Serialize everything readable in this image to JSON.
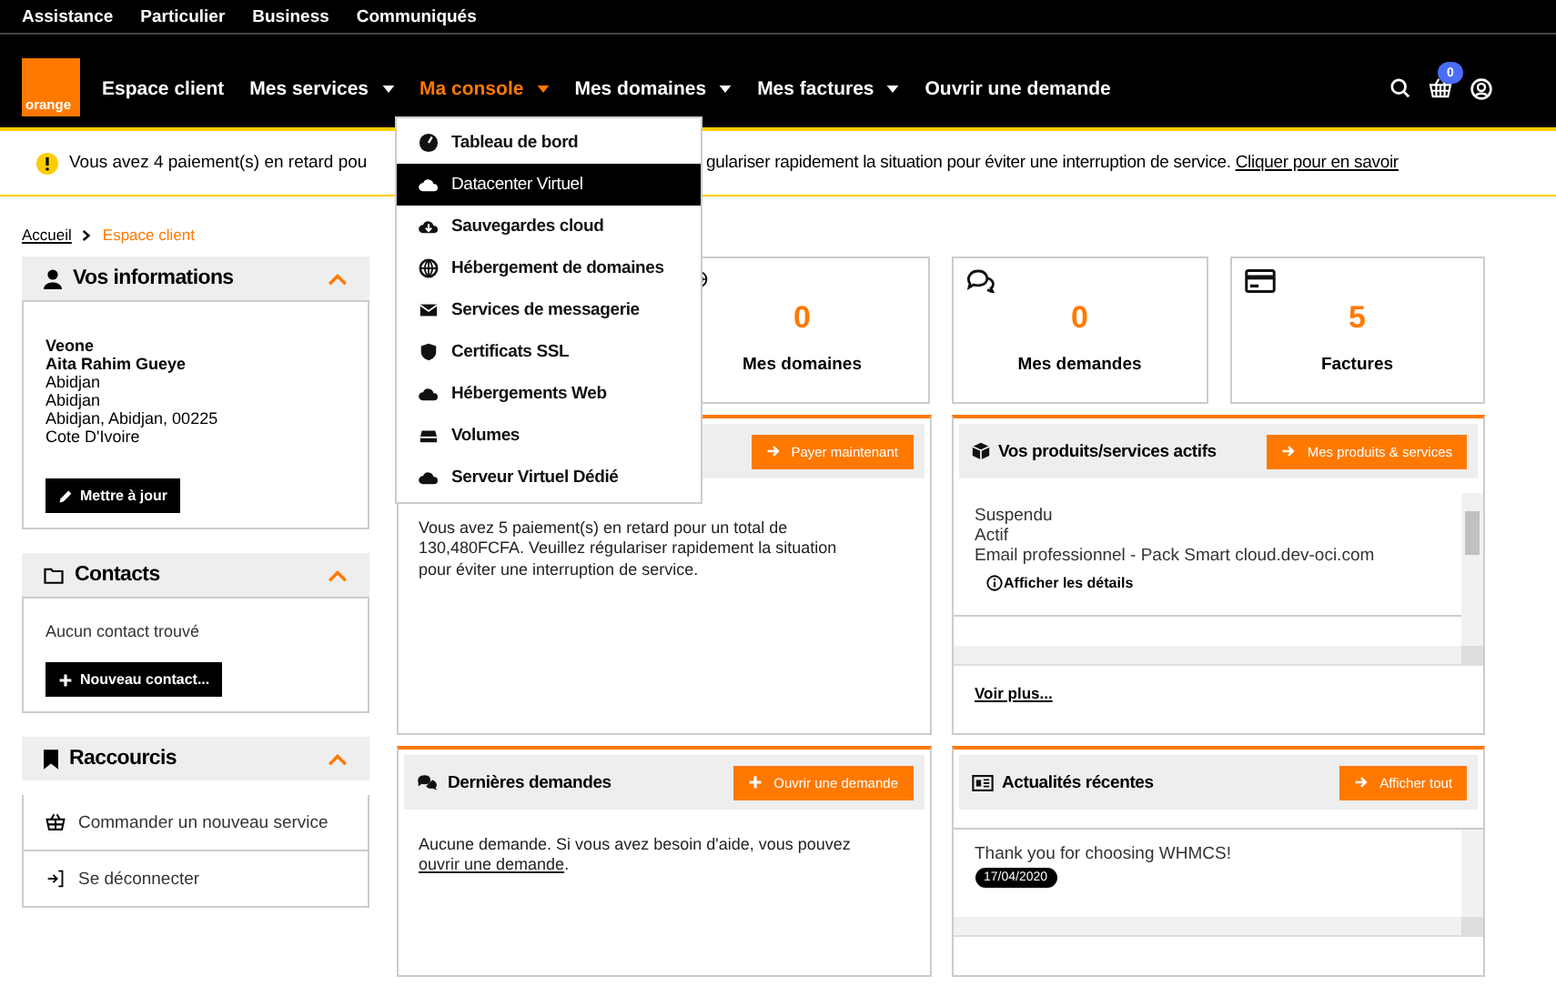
{
  "top_links": [
    "Assistance",
    "Particulier",
    "Business",
    "Communiqués"
  ],
  "logo": {
    "text": "orange"
  },
  "nav": [
    {
      "label": "Espace client",
      "dropdown": false,
      "selected": false
    },
    {
      "label": "Mes services",
      "dropdown": true,
      "selected": false
    },
    {
      "label": "Ma console",
      "dropdown": true,
      "selected": true
    },
    {
      "label": "Mes domaines",
      "dropdown": true,
      "selected": false
    },
    {
      "label": "Mes factures",
      "dropdown": true,
      "selected": false
    },
    {
      "label": "Ouvrir une demande",
      "dropdown": false,
      "selected": false
    }
  ],
  "cart": {
    "count": "0"
  },
  "console_menu": [
    {
      "label": "Tableau de bord",
      "selected": false
    },
    {
      "label": "Datacenter Virtuel",
      "selected": true
    },
    {
      "label": "Sauvegardes cloud",
      "selected": false
    },
    {
      "label": "Hébergement de domaines",
      "selected": false
    },
    {
      "label": "Services de messagerie",
      "selected": false
    },
    {
      "label": "Certificats SSL",
      "selected": false
    },
    {
      "label": "Hébergements Web",
      "selected": false
    },
    {
      "label": "Volumes",
      "selected": false
    },
    {
      "label": "Serveur Virtuel Dédié",
      "selected": false
    }
  ],
  "alert": {
    "text_before": "Vous avez 4 paiement(s) en retard pou",
    "text_after": "gulariser rapidement la situation pour éviter une interruption de service.",
    "link": "Cliquer pour en savoir"
  },
  "breadcrumb": [
    {
      "label": "Accueil",
      "selected": false
    },
    {
      "label": "Espace client",
      "selected": true
    }
  ],
  "sidebar": {
    "info": {
      "title": "Vos informations",
      "expanded": true,
      "lines": [
        {
          "text": "Veone",
          "bold": true
        },
        {
          "text": "Aita Rahim Gueye",
          "bold": true
        },
        {
          "text": "Abidjan",
          "bold": false
        },
        {
          "text": "Abidjan",
          "bold": false
        },
        {
          "text": "Abidjan, Abidjan, 00225",
          "bold": false
        },
        {
          "text": "Cote D'Ivoire",
          "bold": false
        }
      ],
      "button": "Mettre à jour"
    },
    "contacts": {
      "title": "Contacts",
      "expanded": true,
      "empty": "Aucun contact trouvé",
      "button": "Nouveau contact..."
    },
    "shortcuts": {
      "title": "Raccourcis",
      "expanded": true,
      "items": [
        "Commander un nouveau service",
        "Se déconnecter"
      ]
    }
  },
  "tiles": [
    {
      "value": "0",
      "label": "Mes domaines"
    },
    {
      "value": "0",
      "label": "Mes demandes"
    },
    {
      "value": "5",
      "label": "Factures"
    }
  ],
  "payments": {
    "button": "Payer maintenant",
    "text": "Vous avez 5 paiement(s) en retard pour un total de 130,480FCFA. Veuillez régulariser rapidement la situation pour éviter une interruption de service."
  },
  "products": {
    "title": "Vos produits/services actifs",
    "button": "Mes produits & services",
    "items": [
      {
        "lines": [
          "Suspendu",
          "Actif",
          "Email professionnel - Pack Smart cloud.dev-oci.com"
        ],
        "details": "Afficher les détails"
      }
    ],
    "more": "Voir plus..."
  },
  "requests": {
    "title": "Dernières demandes",
    "button": "Ouvrir une demande",
    "text_before": "Aucune demande. Si vous avez besoin d'aide, vous pouvez",
    "link": "ouvrir une demande",
    "text_after": "."
  },
  "news": {
    "title": "Actualités récentes",
    "button": "Afficher tout",
    "items": [
      {
        "title": "Thank you for choosing WHMCS!",
        "date": "17/04/2020"
      }
    ]
  }
}
